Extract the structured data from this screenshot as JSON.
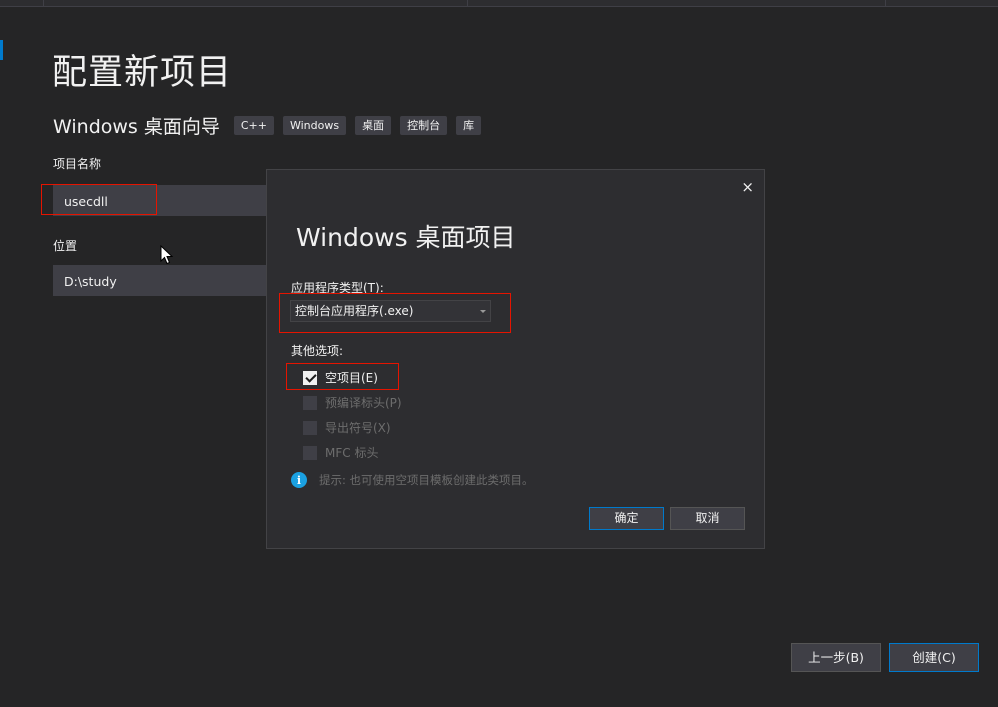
{
  "page": {
    "title": "配置新项目",
    "template_name": "Windows 桌面向导",
    "tags": [
      "C++",
      "Windows",
      "桌面",
      "控制台",
      "库"
    ]
  },
  "project_name": {
    "label": "项目名称",
    "value": "usecdll"
  },
  "location": {
    "label": "位置",
    "value": "D:\\study"
  },
  "dialog": {
    "close_glyph": "×",
    "title": "Windows 桌面项目",
    "app_type_label": "应用程序类型(T):",
    "app_type_value": "控制台应用程序(.exe)",
    "other_options_label": "其他选项:",
    "options": [
      {
        "label": "空项目(E)",
        "checked": true,
        "enabled": true
      },
      {
        "label": "预编译标头(P)",
        "checked": false,
        "enabled": false
      },
      {
        "label": "导出符号(X)",
        "checked": false,
        "enabled": false
      },
      {
        "label": "MFC 标头",
        "checked": false,
        "enabled": false
      }
    ],
    "hint_icon": "i",
    "hint": "提示: 也可使用空项目模板创建此类项目。",
    "ok_label": "确定",
    "cancel_label": "取消"
  },
  "footer": {
    "back_label": "上一步(B)",
    "create_label": "创建(C)"
  },
  "colors": {
    "background": "#252526",
    "accent": "#007acc",
    "highlight": "#e51400",
    "info": "#1ba1e2"
  }
}
